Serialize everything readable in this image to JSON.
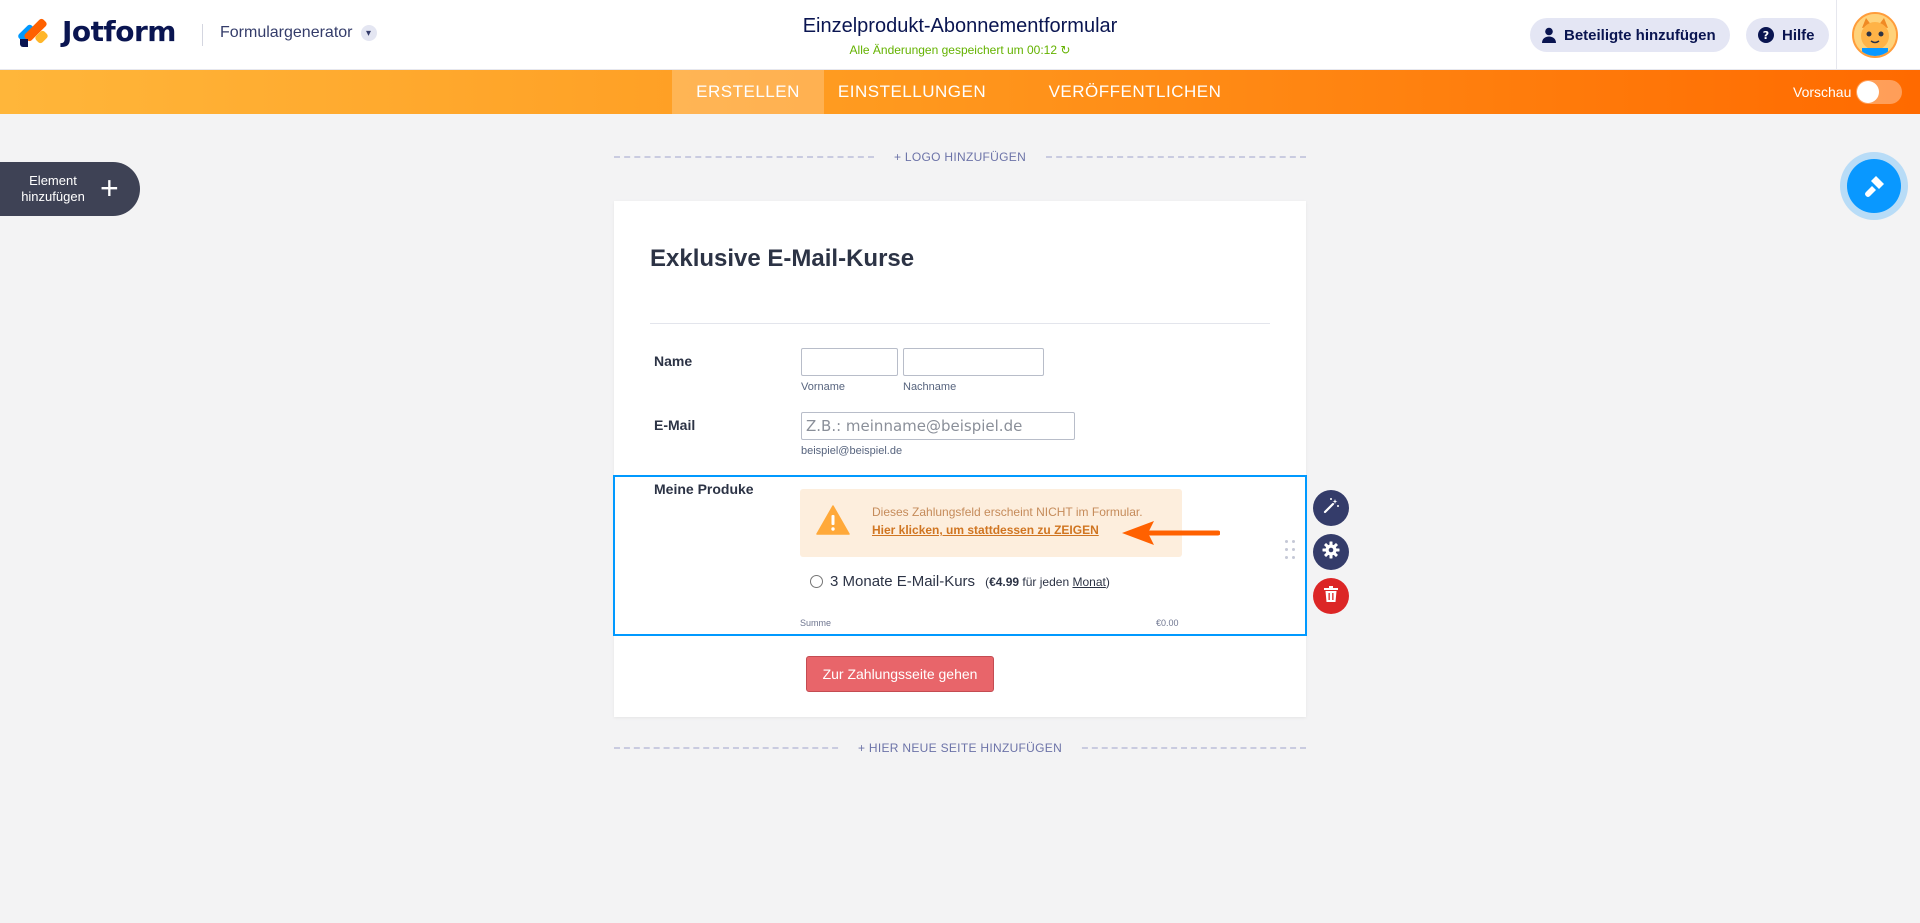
{
  "header": {
    "logo_text": "Jotform",
    "builder_menu_label": "Formulargenerator",
    "form_title": "Einzelprodukt-Abonnementformular",
    "save_status": "Alle Änderungen gespeichert um 00:12",
    "invite_label": "Beteiligte hinzufügen",
    "help_label": "Hilfe"
  },
  "nav": {
    "tabs": [
      {
        "label": "ERSTELLEN",
        "active": true
      },
      {
        "label": "EINSTELLUNGEN",
        "active": false
      },
      {
        "label": "VERÖFFENTLICHEN",
        "active": false
      }
    ],
    "preview_label": "Vorschau",
    "preview_enabled": false
  },
  "sidebar": {
    "add_element_label": "Element hinzufügen"
  },
  "builder": {
    "add_logo_label": "+ LOGO HINZUFÜGEN",
    "add_page_label": "+ HIER NEUE SEITE HINZUFÜGEN"
  },
  "form": {
    "heading": "Exklusive E-Mail-Kurse",
    "name": {
      "label": "Name",
      "first_sublabel": "Vorname",
      "last_sublabel": "Nachname"
    },
    "email": {
      "label": "E-Mail",
      "placeholder": "Z.B.: meinname@beispiel.de",
      "sublabel": "beispiel@beispiel.de"
    },
    "products": {
      "label": "Meine Produke",
      "warning_text": "Dieses Zahlungsfeld erscheint NICHT im Formular.",
      "warning_link": "Hier klicken, um stattdessen zu ZEIGEN",
      "item_name": "3 Monate E-Mail-Kurs",
      "item_price": "€4.99",
      "item_price_prefix": "(",
      "item_price_mid": " für jeden ",
      "item_period": "Monat",
      "item_price_suffix": ")",
      "sum_label": "Summe",
      "sum_value": "€0.00"
    },
    "submit_label": "Zur Zahlungsseite gehen"
  },
  "colors": {
    "accent_orange": "#ff6100",
    "selection_blue": "#0099ff",
    "submit_red": "#e8656a",
    "save_green": "#64b200"
  }
}
